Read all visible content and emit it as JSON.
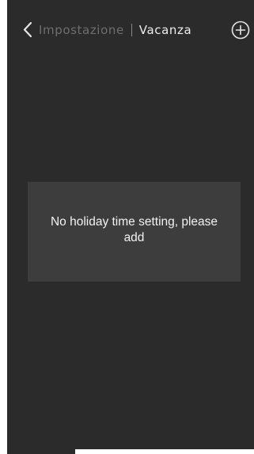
{
  "header": {
    "back_icon": "chevron-left-icon",
    "parent_label": "Impostazione",
    "title": "Vacanza",
    "add_icon": "plus-circle-icon"
  },
  "empty_state": {
    "message": "No holiday time setting, please add"
  },
  "colors": {
    "background": "#2b2b2b",
    "card": "#3d3d3d",
    "text_primary": "#ededed",
    "text_muted": "#6e6e6e"
  }
}
